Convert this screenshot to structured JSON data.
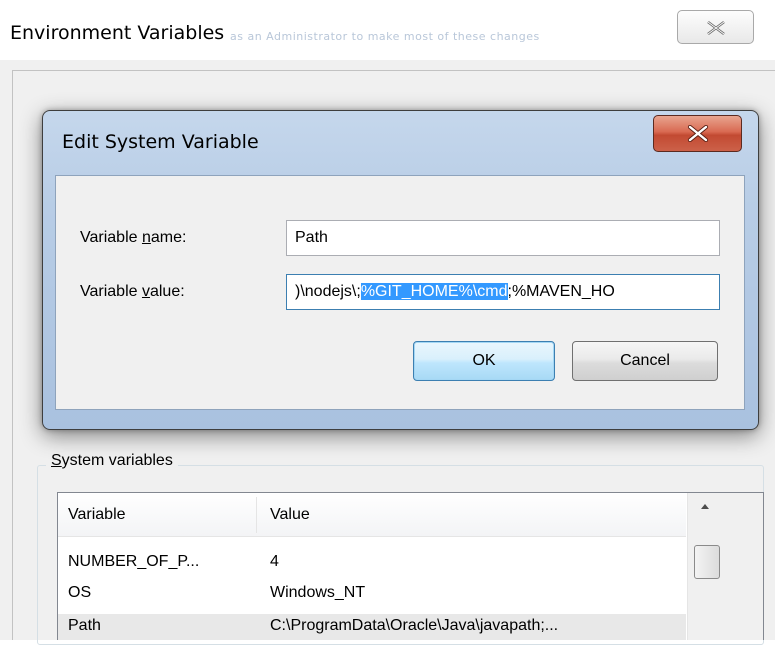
{
  "background_window": {
    "title": "Environment Variables",
    "blurred_text": "as an Administrator to make most of these changes"
  },
  "dialog": {
    "title": "Edit System Variable",
    "name_label_pre": "Variable ",
    "name_label_key": "n",
    "name_label_post": "ame:",
    "name_value": "Path",
    "value_label_pre": "Variable ",
    "value_label_key": "v",
    "value_label_post": "alue:",
    "value_before": ")\\nodejs\\;",
    "value_selected": "%GIT_HOME%\\cmd",
    "value_after": ";%MAVEN_HO",
    "ok_label": "OK",
    "cancel_label": "Cancel"
  },
  "system_variables": {
    "group_label_key": "S",
    "group_label_rest": "ystem variables",
    "columns": [
      "Variable",
      "Value"
    ],
    "rows": [
      {
        "variable": "NUMBER_OF_P...",
        "value": "4"
      },
      {
        "variable": "OS",
        "value": "Windows_NT"
      },
      {
        "variable": "Path",
        "value": "C:\\ProgramData\\Oracle\\Java\\javapath;..."
      }
    ]
  }
}
